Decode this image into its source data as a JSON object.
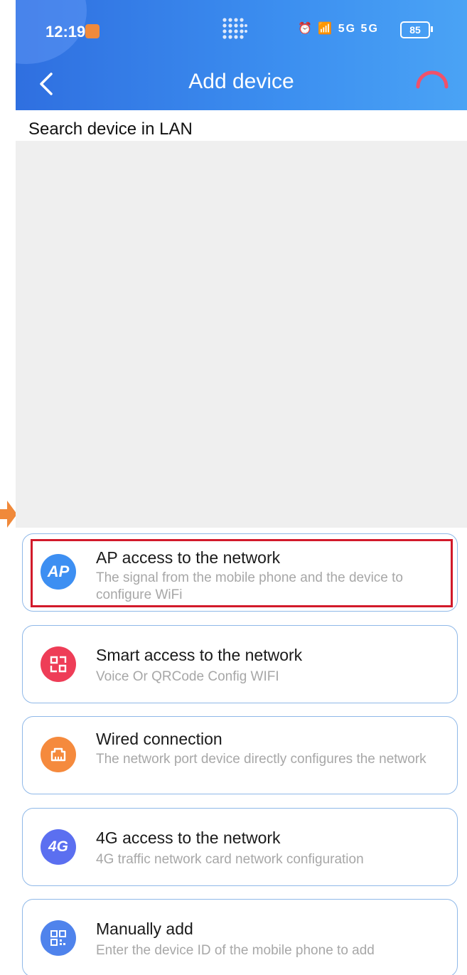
{
  "status_bar": {
    "time": "12:19",
    "icons": [
      "alarm-icon",
      "wifi-icon",
      "5g-signal-icon",
      "5g-signal-icon"
    ],
    "signal_1": "5G",
    "signal_2": "5G",
    "battery": "85"
  },
  "header": {
    "title": "Add device",
    "back_icon": "chevron-left-icon",
    "loading_icon": "spinner-icon",
    "background_color": "#3580e8"
  },
  "lan_section": {
    "label": "Search device in LAN"
  },
  "options": [
    {
      "icon": "AP",
      "icon_color": "#3d8ff2",
      "title": "AP access to the network",
      "description": "The signal from the mobile phone and the device to configure WiFi",
      "highlighted": true
    },
    {
      "icon": "qr-smart-icon",
      "icon_color": "#ee3d57",
      "title": "Smart access to the network",
      "description": "Voice Or QRCode Config WIFI"
    },
    {
      "icon": "ethernet-port-icon",
      "icon_color": "#f58a3d",
      "title": "Wired connection",
      "description": "The network port device directly configures the network"
    },
    {
      "icon": "4G",
      "icon_color": "#5b6ff0",
      "title": "4G access to the network",
      "description": "4G traffic network card network configuration"
    },
    {
      "icon": "qrcode-icon",
      "icon_color": "#4f83ec",
      "title": "Manually add",
      "description": "Enter the device ID of the mobile phone to add"
    }
  ],
  "highlight_color": "#d21a2a",
  "pointer_arrow_color": "#f0893a"
}
